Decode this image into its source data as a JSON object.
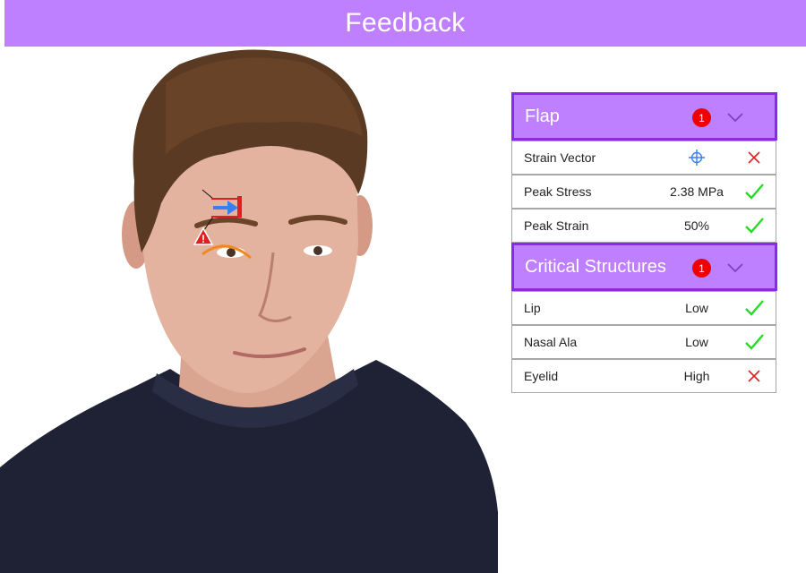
{
  "header": {
    "title": "Feedback"
  },
  "colors": {
    "accent": "#bf80ff",
    "accent_border": "#8a2be2",
    "badge": "#ee0000",
    "ok": "#22dd22",
    "bad": "#dd2222",
    "arrow": "#3a7ff0",
    "alert": "#e02020",
    "arc": "#f08a20"
  },
  "sections": [
    {
      "title": "Flap",
      "badge": "1",
      "rows": [
        {
          "label": "Strain Vector",
          "value": "",
          "icon": "crosshair-icon",
          "status": "fail"
        },
        {
          "label": "Peak Stress",
          "value": "2.38 MPa",
          "status": "pass"
        },
        {
          "label": "Peak Strain",
          "value": "50%",
          "status": "pass"
        }
      ]
    },
    {
      "title": "Critical Structures",
      "badge": "1",
      "rows": [
        {
          "label": "Lip",
          "value": "Low",
          "status": "pass"
        },
        {
          "label": "Nasal Ala",
          "value": "Low",
          "status": "pass"
        },
        {
          "label": "Eyelid",
          "value": "High",
          "status": "fail"
        }
      ]
    }
  ],
  "overlay": {
    "annotations": [
      "strain-arrow",
      "alert-triangle",
      "eyebrow-arc"
    ]
  }
}
